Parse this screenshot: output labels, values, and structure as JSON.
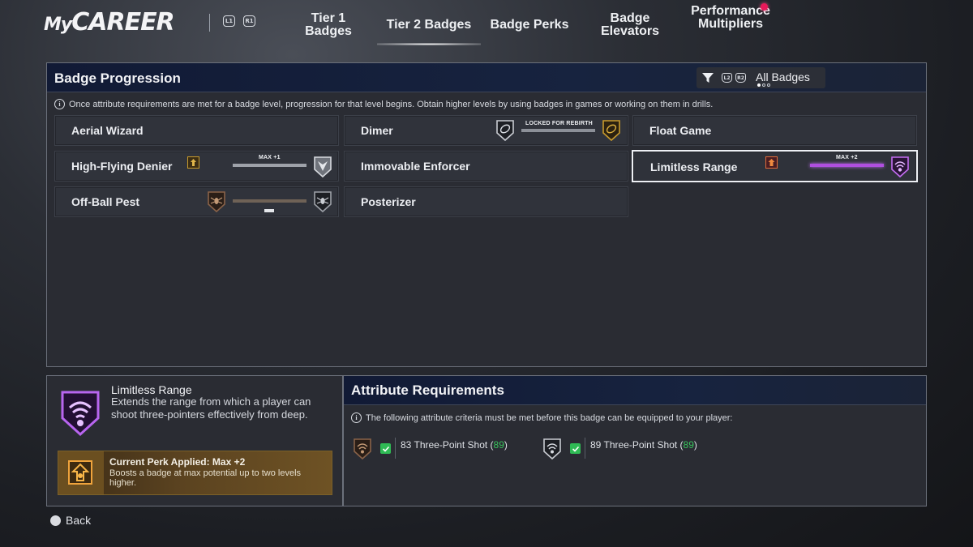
{
  "header": {
    "logo": {
      "my": "My",
      "career": "CAREER"
    },
    "bumper_left": "L1",
    "bumper_right": "R1",
    "tabs": [
      {
        "label": "Tier 1 Badges",
        "active": false
      },
      {
        "label": "Tier 2 Badges",
        "active": true
      },
      {
        "label": "Badge Perks",
        "active": false
      },
      {
        "label_line1": "Badge",
        "label_line2": "Elevators",
        "active": false
      },
      {
        "label_line1": "Performance",
        "label_line2": "Multipliers",
        "active": false,
        "notification": true
      }
    ]
  },
  "badge_progression": {
    "title": "Badge Progression",
    "filter": {
      "label": "All Badges",
      "trigger_left": "L2",
      "trigger_right": "R2",
      "page_dots": 3,
      "active_dot": 1
    },
    "info_text": "Once attribute requirements are met for a badge level, progression for that level begins. Obtain higher levels by using badges in games or working on them in drills.",
    "badges": [
      {
        "name": "Aerial Wizard"
      },
      {
        "name": "Dimer",
        "status_label": "LOCKED FOR REBIRTH"
      },
      {
        "name": "Float Game"
      },
      {
        "name": "High-Flying Denier",
        "status_label": "MAX +1"
      },
      {
        "name": "Immovable Enforcer"
      },
      {
        "name": "Limitless Range",
        "status_label": "MAX +2",
        "selected": true
      },
      {
        "name": "Off-Ball Pest"
      },
      {
        "name": "Posterizer"
      }
    ]
  },
  "detail": {
    "title": "Limitless Range",
    "description": "Extends the range from which a player can shoot three-pointers effectively from deep.",
    "perk_title": "Current Perk Applied: Max +2",
    "perk_description": "Boosts a badge at max potential up to two levels higher."
  },
  "requirements": {
    "title": "Attribute Requirements",
    "info_text": "The following attribute criteria must be met before this badge can be equipped to your player:",
    "items": [
      {
        "value": "83",
        "attribute": "Three-Point Shot",
        "current": "89"
      },
      {
        "value": "89",
        "attribute": "Three-Point Shot",
        "current": "89"
      }
    ]
  },
  "footer": {
    "back_label": "Back"
  },
  "colors": {
    "accent_purple": "#b04fe0",
    "gold": "#c89a2c",
    "check_green": "#2fbb55",
    "header_navy": "#111a35"
  }
}
